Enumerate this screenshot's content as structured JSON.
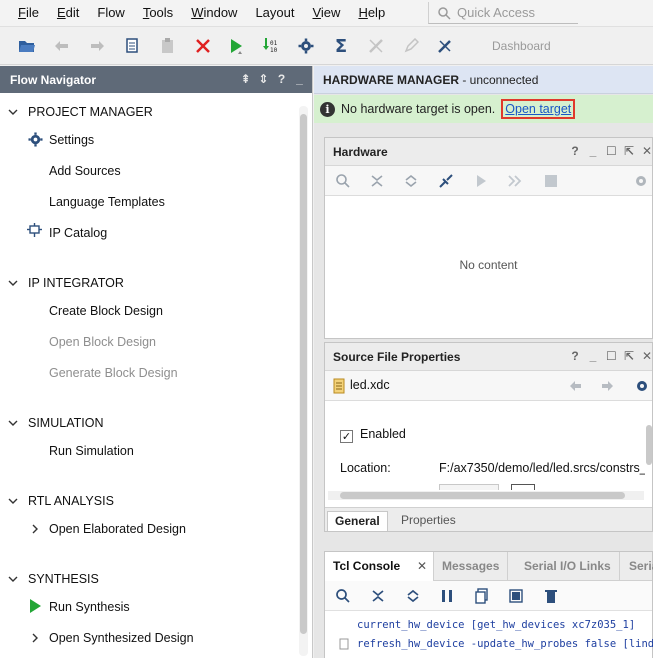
{
  "menu": {
    "items": [
      "File",
      "Edit",
      "Flow",
      "Tools",
      "Window",
      "Layout",
      "View",
      "Help"
    ],
    "underline": [
      "F",
      "E",
      "",
      "T",
      "W",
      "",
      "V",
      "H"
    ],
    "rest": [
      "ile",
      "dit",
      "Flow",
      "ools",
      "indow",
      "Layout",
      "iew",
      "elp"
    ],
    "quick_access_placeholder": "Quick Access"
  },
  "toolbar": {
    "dashboard_label": "Dashboard",
    "icons": [
      "open-project-icon",
      "undo-icon",
      "redo-icon",
      "copy-icon",
      "paste-icon",
      "delete-icon",
      "run-icon",
      "bitstream-icon",
      "settings-icon",
      "sigma-icon",
      "tools-disabled-icon",
      "pen-disabled-icon",
      "wrench-cancel-icon"
    ]
  },
  "flow_navigator": {
    "title": "Flow Navigator",
    "sections": [
      {
        "title": "PROJECT MANAGER",
        "items": [
          {
            "label": "Settings",
            "icon": "gear-icon",
            "disabled": false
          },
          {
            "label": "Add Sources",
            "icon": "",
            "disabled": false
          },
          {
            "label": "Language Templates",
            "icon": "",
            "disabled": false
          },
          {
            "label": "IP Catalog",
            "icon": "ip-icon",
            "disabled": false
          }
        ]
      },
      {
        "title": "IP INTEGRATOR",
        "items": [
          {
            "label": "Create Block Design",
            "disabled": false
          },
          {
            "label": "Open Block Design",
            "disabled": true
          },
          {
            "label": "Generate Block Design",
            "disabled": true
          }
        ]
      },
      {
        "title": "SIMULATION",
        "items": [
          {
            "label": "Run Simulation",
            "disabled": false
          }
        ]
      },
      {
        "title": "RTL ANALYSIS",
        "items": [
          {
            "label": "Open Elaborated Design",
            "disabled": false
          }
        ]
      },
      {
        "title": "SYNTHESIS",
        "items": [
          {
            "label": "Run Synthesis",
            "icon": "run-green-icon",
            "disabled": false
          },
          {
            "label": "Open Synthesized Design",
            "disabled": false
          }
        ]
      }
    ]
  },
  "hardware_manager": {
    "title": "HARDWARE MANAGER",
    "status": " - unconnected",
    "banner_text": "No hardware target is open.",
    "banner_link": "Open target"
  },
  "hardware_panel": {
    "title": "Hardware",
    "empty_text": "No content"
  },
  "source_props": {
    "title": "Source File Properties",
    "file": "led.xdc",
    "enabled_label": "Enabled",
    "location_label": "Location:",
    "location_value": "F:/ax7350/demo/led/led.srcs/constrs_",
    "tabs": [
      "General",
      "Properties"
    ],
    "active_tab": "General"
  },
  "tcl": {
    "tabs": [
      "Tcl Console",
      "Messages",
      "Serial I/O Links",
      "Seria"
    ],
    "active_tab": "Tcl Console",
    "lines": [
      "current_hw_device [get_hw_devices xc7z035_1]",
      "refresh_hw_device -update_hw_probes false [lindex"
    ]
  },
  "colors": {
    "accent_link": "#1a56c6",
    "highlight_box": "#e0392b",
    "banner_bg": "#d6f0cf",
    "header_bg": "#5f6a78"
  }
}
